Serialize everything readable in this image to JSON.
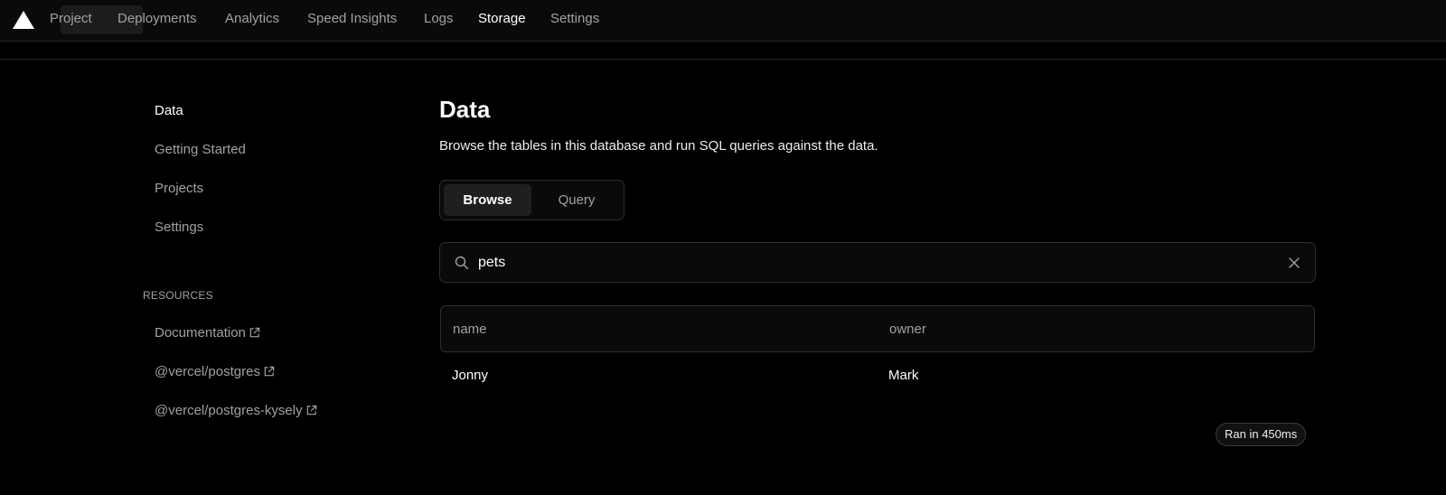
{
  "topnav": {
    "tabs": [
      {
        "label": "Project"
      },
      {
        "label": "Deployments"
      },
      {
        "label": "Analytics"
      },
      {
        "label": "Speed Insights"
      },
      {
        "label": "Logs"
      },
      {
        "label": "Storage"
      },
      {
        "label": "Settings"
      }
    ],
    "active_tab": "Storage"
  },
  "sidebar": {
    "items": [
      {
        "label": "Data",
        "active": true
      },
      {
        "label": "Getting Started"
      },
      {
        "label": "Projects"
      },
      {
        "label": "Settings"
      }
    ],
    "resources_heading": "RESOURCES",
    "resources": [
      {
        "label": "Documentation",
        "icon": "external-link-icon"
      },
      {
        "label": "@vercel/postgres",
        "icon": "external-link-icon"
      },
      {
        "label": "@vercel/postgres-kysely",
        "icon": "external-link-icon"
      }
    ]
  },
  "main": {
    "title": "Data",
    "description": "Browse the tables in this database and run SQL queries against the data.",
    "segments": {
      "browse": "Browse",
      "query": "Query",
      "selected": "Browse"
    },
    "search": {
      "value": "pets",
      "placeholder": ""
    },
    "table": {
      "columns": [
        "name",
        "owner"
      ],
      "rows": [
        [
          "Jonny",
          "Mark"
        ]
      ]
    },
    "timing_badge": "Ran in 450ms"
  },
  "colors": {
    "background": "#000000",
    "surface": "#0a0a0a",
    "border": "#2e2e2e",
    "text_primary": "#ffffff",
    "text_muted": "#a1a1a1"
  }
}
